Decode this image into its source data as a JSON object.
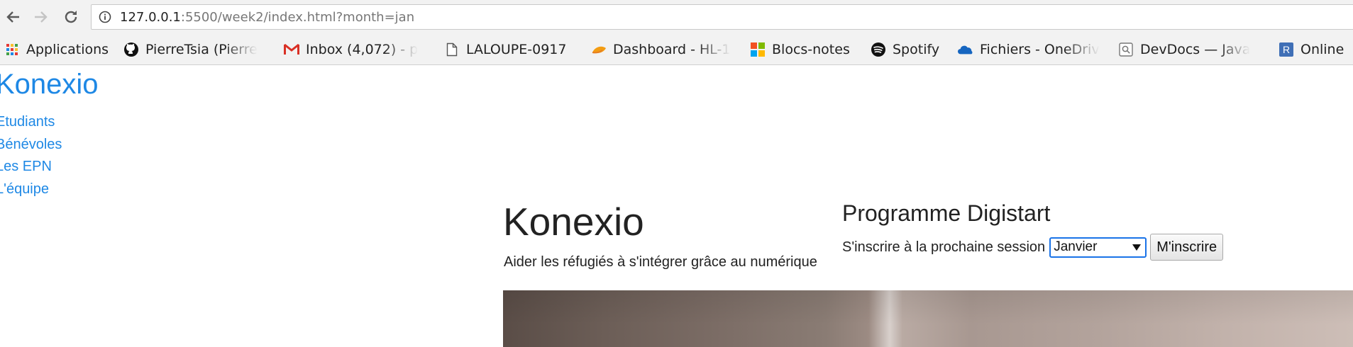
{
  "browser": {
    "url_host": "127.0.0.1",
    "url_rest": ":5500/week2/index.html?month=jan",
    "bookmarks": [
      {
        "label": "Applications",
        "icon": "apps-grid-icon"
      },
      {
        "label": "PierreTsia (Pierre",
        "icon": "github-icon"
      },
      {
        "label": "Inbox (4,072) - p",
        "icon": "gmail-icon"
      },
      {
        "label": "LALOUPE-0917",
        "icon": "page-icon"
      },
      {
        "label": "Dashboard - HL-1",
        "icon": "dashboard-icon"
      },
      {
        "label": "Blocs-notes",
        "icon": "microsoft-icon"
      },
      {
        "label": "Spotify",
        "icon": "spotify-icon"
      },
      {
        "label": "Fichiers - OneDriv",
        "icon": "onedrive-icon"
      },
      {
        "label": "DevDocs — Java",
        "icon": "devdocs-icon"
      },
      {
        "label": "Online",
        "icon": "r-icon"
      }
    ],
    "colors": {
      "chrome_bg": "#f2f2f2",
      "link_blue": "#1e88e5"
    }
  },
  "site": {
    "brand": "Konexio",
    "nav": [
      {
        "label": "Etudiants"
      },
      {
        "label": "Bénévoles"
      },
      {
        "label": "Les EPN"
      },
      {
        "label": "L'équipe"
      }
    ],
    "hero": {
      "title": "Konexio",
      "subtitle": "Aider les réfugiés à s'intégrer grâce au numérique"
    },
    "program": {
      "title": "Programme Digistart",
      "signup_label": "S'inscrire à la prochaine session",
      "selected_month": "Janvier",
      "button_label": "M'inscrire"
    }
  }
}
